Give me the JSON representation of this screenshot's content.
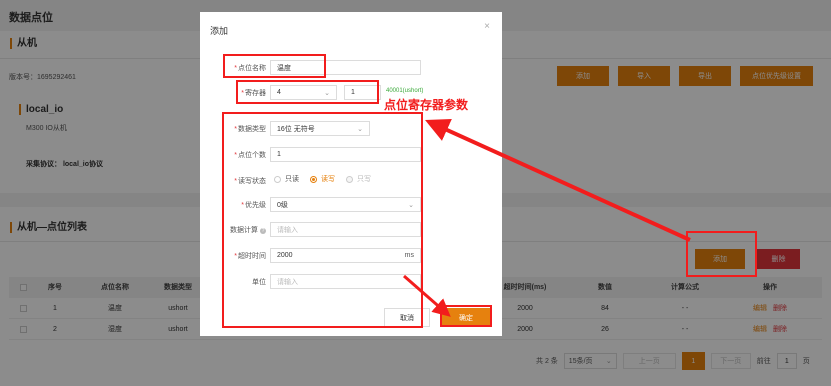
{
  "page": {
    "title": "数据点位",
    "section1_title": "从机",
    "version": "版本号：1695292461",
    "toolbar": [
      "添加",
      "导入",
      "导出",
      "点位优先级设置"
    ],
    "slave": {
      "name": "local_io",
      "desc": "M300 IO从机",
      "protocol": "采集协议：  local_io协议"
    },
    "section2_title": "从机—点位列表",
    "add_label": "添加",
    "delete_label": "删除",
    "table": {
      "headers": [
        "序号",
        "点位名称",
        "数据类型",
        "超时时间(ms)",
        "数值",
        "计算公式",
        "操作"
      ],
      "rows": [
        {
          "index": "1",
          "name": "温度",
          "type": "ushort",
          "timeout": "2000",
          "value": "84",
          "formula": "- -",
          "edit": "编辑",
          "delete": "删除"
        },
        {
          "index": "2",
          "name": "湿度",
          "type": "ushort",
          "timeout": "2000",
          "value": "26",
          "formula": "- -",
          "edit": "编辑",
          "delete": "删除"
        }
      ]
    },
    "pager": {
      "total": "共 2 条",
      "page_size": "15条/页",
      "prev": "上一页",
      "current": "1",
      "next": "下一页",
      "goto_prefix": "前往",
      "goto_value": "1",
      "goto_suffix": "页"
    }
  },
  "dialog": {
    "title": "添加",
    "close": "×",
    "fields": {
      "name": {
        "label": "点位名称",
        "value": "温度"
      },
      "register": {
        "label": "寄存器",
        "value": "4",
        "address": "1",
        "hint": "40001(ushort)"
      },
      "data_type": {
        "label": "数据类型",
        "value": "16位 无符号"
      },
      "count": {
        "label": "点位个数",
        "value": "1"
      },
      "rw": {
        "label": "读写状态",
        "options": [
          "只读",
          "读写",
          "只写"
        ],
        "selected": 1
      },
      "priority": {
        "label": "优先级",
        "value": "0级"
      },
      "calc": {
        "label": "数据计算",
        "placeholder": "请输入"
      },
      "timeout": {
        "label": "超时时间",
        "value": "2000",
        "unit": "ms"
      },
      "unit": {
        "label": "单位",
        "placeholder": "请输入"
      }
    },
    "cancel": "取消",
    "ok": "确定"
  },
  "annotation": {
    "text": "点位寄存器参数",
    "color": "#f21d1d"
  },
  "colors": {
    "accent": "#e6810e",
    "danger": "#e0363b",
    "hint": "#39a939"
  }
}
